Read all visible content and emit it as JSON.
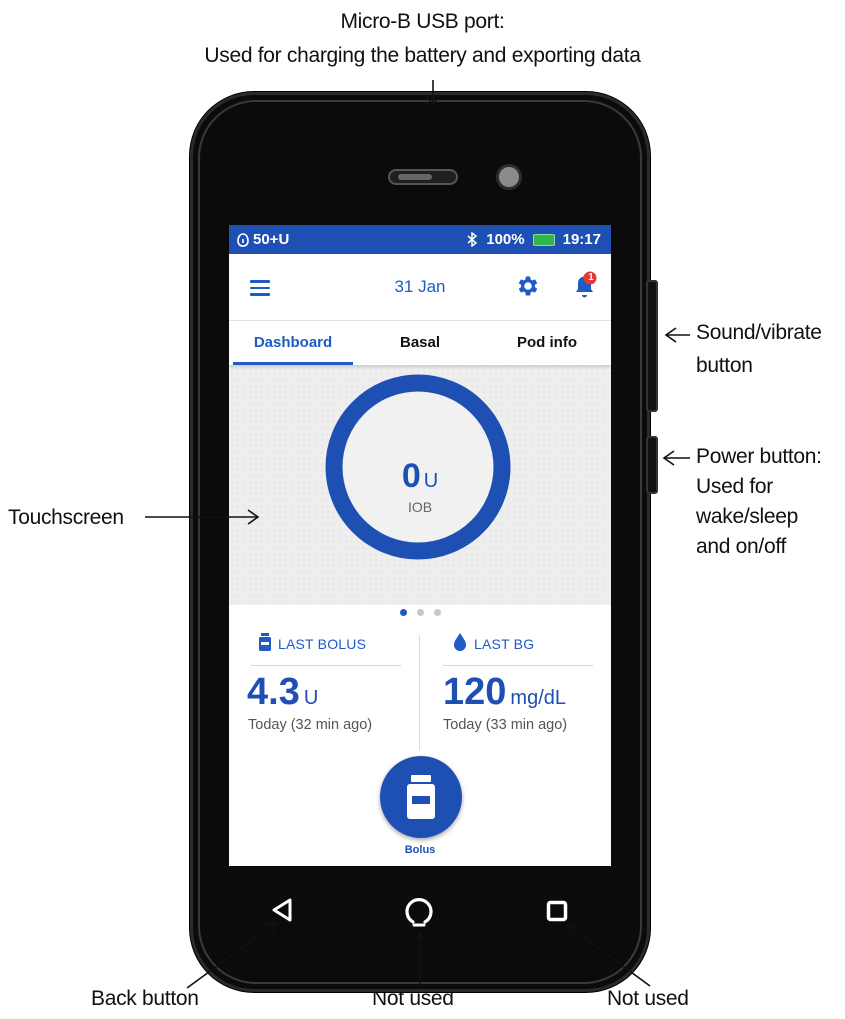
{
  "callouts": {
    "usb_line1": "Micro-B USB port:",
    "usb_line2": "Used for charging the battery and exporting data",
    "sound_line1": "Sound/vibrate",
    "sound_line2": "button",
    "power_line1": "Power button:",
    "power_line2": "Used for",
    "power_line3": "wake/sleep",
    "power_line4": "and on/off",
    "touchscreen": "Touchscreen",
    "back": "Back button",
    "home": "Not used",
    "recent": "Not used"
  },
  "status_bar": {
    "pod_insulin": "50+U",
    "battery": "100%",
    "time": "19:17",
    "bluetooth_icon": "bluetooth-icon"
  },
  "app_bar": {
    "date": "31 Jan",
    "notification_count": "1"
  },
  "tabs": [
    {
      "label": "Dashboard",
      "active": true
    },
    {
      "label": "Basal",
      "active": false
    },
    {
      "label": "Pod info",
      "active": false
    }
  ],
  "iob": {
    "value": "0",
    "unit": "U",
    "label": "IOB"
  },
  "last_bolus": {
    "title": "LAST BOLUS",
    "value": "4.3",
    "unit": "U",
    "when": "Today (32 min ago)"
  },
  "last_bg": {
    "title": "LAST BG",
    "value": "120",
    "unit": "mg/dL",
    "when": "Today (33 min ago)"
  },
  "bolus_button": {
    "label": "Bolus"
  },
  "colors": {
    "primary": "#1e4fb3",
    "accent": "#1e5bc6",
    "notification": "#e53935",
    "battery": "#2fb54a"
  }
}
